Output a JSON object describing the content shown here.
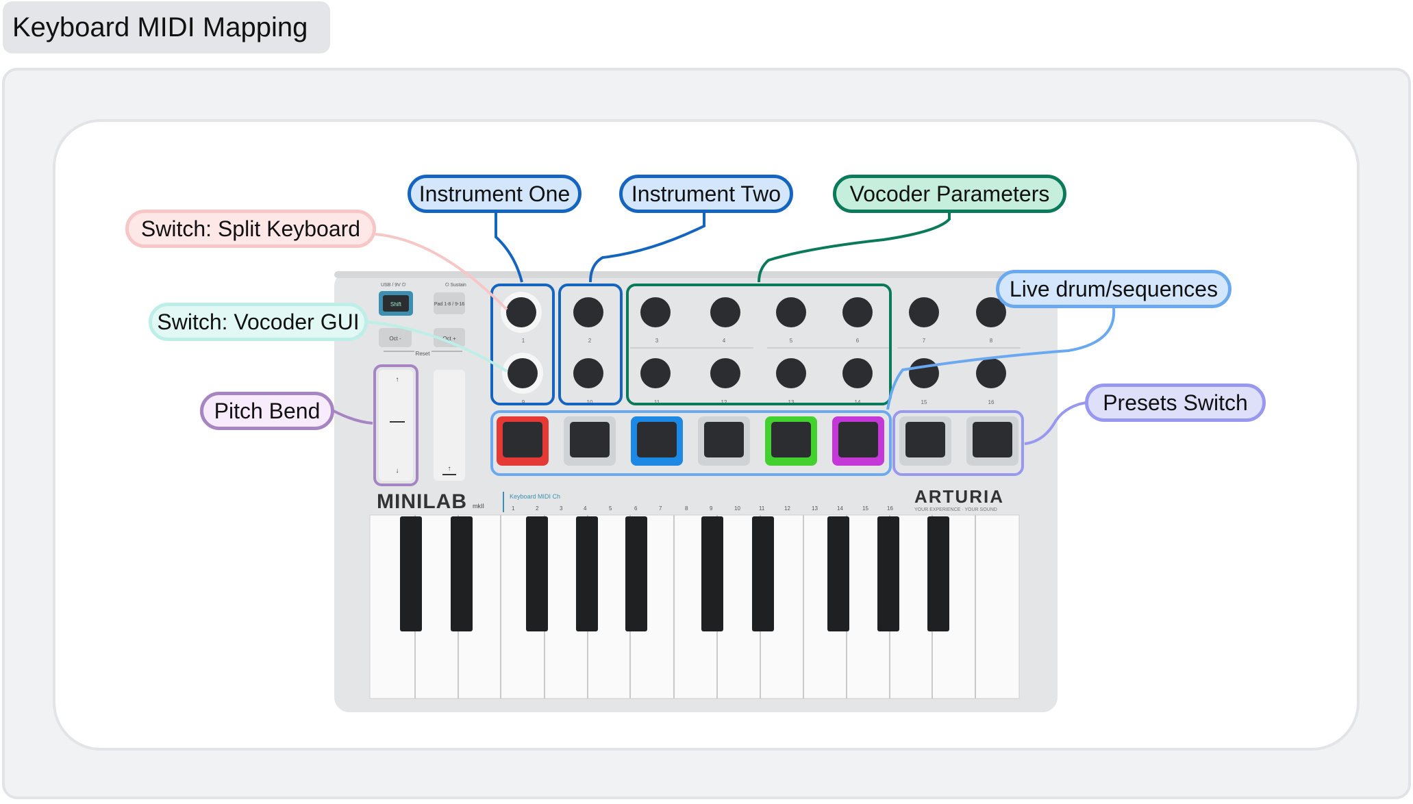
{
  "page": {
    "title": "Keyboard MIDI Mapping"
  },
  "device": {
    "brand": "ARTURIA",
    "brand_tagline": "YOUR EXPERIENCE · YOUR SOUND",
    "model": "MINILAB",
    "model_suffix": "mkII",
    "midi_ch_label": "Keyboard MIDI Ch",
    "top_labels": [
      "USB / 9V ⏻",
      "⏻ Sustain"
    ],
    "buttons": [
      "Shift",
      "Pad 1-8 / 9-16",
      "Oct -",
      "Oct +",
      "Reset"
    ],
    "knob_numbers": [
      "1",
      "2",
      "3",
      "4",
      "5",
      "6",
      "7",
      "8",
      "9",
      "10",
      "11",
      "12",
      "13",
      "14",
      "15",
      "16"
    ],
    "channel_numbers": [
      "1",
      "2",
      "3",
      "4",
      "5",
      "6",
      "7",
      "8",
      "9",
      "10",
      "11",
      "12",
      "13",
      "14",
      "15",
      "16"
    ]
  },
  "callouts": {
    "instrument_one": "Instrument One",
    "instrument_two": "Instrument Two",
    "vocoder_parameters": "Vocoder Parameters",
    "split_keyboard": "Switch: Split Keyboard",
    "vocoder_gui": "Switch: Vocoder GUI",
    "pitch_bend": "Pitch Bend",
    "live_drum": "Live drum/sequences",
    "presets_switch": "Presets Switch"
  },
  "colors": {
    "instrument_one": "#1565c0",
    "instrument_two": "#1565c0",
    "vocoder": "#0b7a5a",
    "split_keyboard": "#f7c6c6",
    "vocoder_gui": "#bdeee8",
    "pitch_bend": "#a585c2",
    "live_drum": "#6aa9f0",
    "presets_switch": "#9898f0",
    "pads": [
      "#e53935",
      "#cfd3d6",
      "#1e88e5",
      "#cfd3d6",
      "#43d12f",
      "#c538d8",
      "#cfd3d6",
      "#cfd3d6"
    ]
  }
}
